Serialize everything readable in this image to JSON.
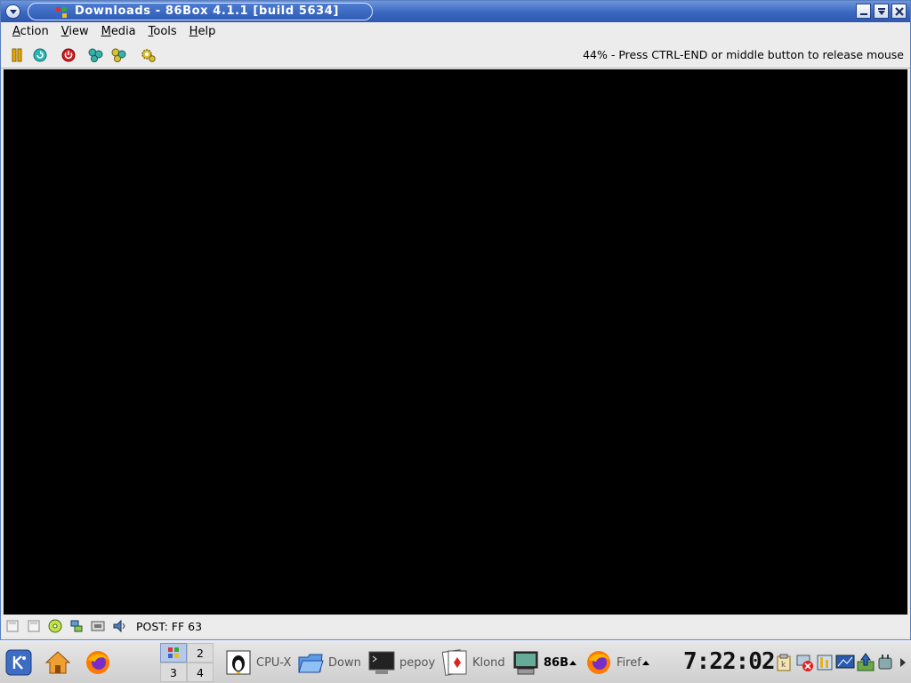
{
  "window": {
    "title": "Downloads - 86Box 4.1.1 [build 5634]"
  },
  "menubar": {
    "items": [
      {
        "label": "Action",
        "accel": "A",
        "rest": "ction"
      },
      {
        "label": "View",
        "accel": "V",
        "rest": "iew"
      },
      {
        "label": "Media",
        "accel": "M",
        "rest": "edia"
      },
      {
        "label": "Tools",
        "accel": "T",
        "rest": "ools"
      },
      {
        "label": "Help",
        "accel": "H",
        "rest": "elp"
      }
    ]
  },
  "toolbar": {
    "buttons": [
      "pause-icon",
      "reset-icon",
      "power-icon",
      "ctrl-alt-del-icon",
      "ctrl-alt-esc-icon",
      "settings-icon"
    ],
    "status_text": "44% - Press CTRL-END or middle button to release mouse"
  },
  "statusbar": {
    "icons": [
      "floppy-a-icon",
      "floppy-b-icon",
      "cdrom-icon",
      "hdd-icon",
      "network-icon",
      "sound-icon"
    ],
    "post_text": "POST: FF 63"
  },
  "taskbar": {
    "launchers": [
      "kde-menu-icon",
      "home-icon",
      "firefox-icon"
    ],
    "pager": [
      "1",
      "2",
      "3",
      "4"
    ],
    "tasks": [
      {
        "label": "CPU-X",
        "icon": "tux-icon"
      },
      {
        "label": "Down",
        "icon": "folder-icon"
      },
      {
        "label": "pepoy",
        "icon": "terminal-icon"
      },
      {
        "label": "Klond",
        "icon": "cards-icon"
      },
      {
        "label": "86B",
        "icon": "86box-icon"
      },
      {
        "label": "Firef",
        "icon": "firefox-icon"
      }
    ],
    "clock": "7:22:02",
    "tray": [
      "klipper-icon",
      "network-error-icon",
      "kmix-icon",
      "display-icon",
      "update-icon",
      "power-icon"
    ],
    "colors": {
      "accent": "#3a67c0",
      "screen": "#000000"
    }
  }
}
